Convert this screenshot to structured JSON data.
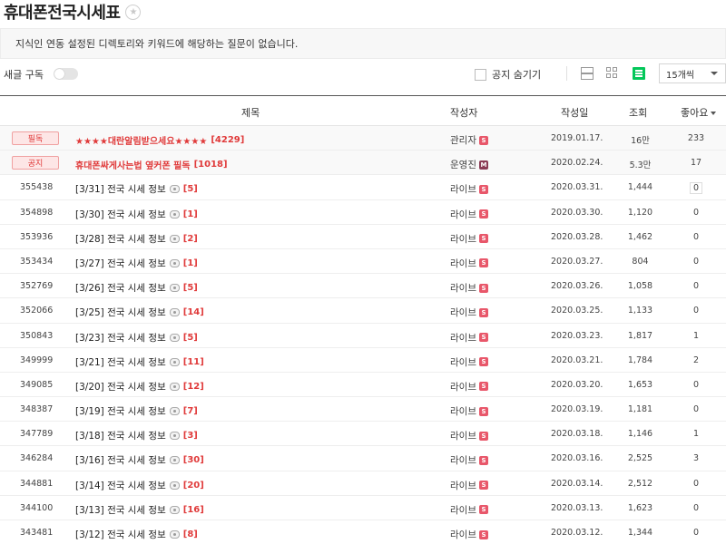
{
  "header": {
    "title": "휴대폰전국시세표",
    "star_icon": "star-icon"
  },
  "notice": "지식인 연동 설정된 디렉토리와 키워드에 해당하는 질문이 없습니다.",
  "toolbar": {
    "subscribe_label": "새글 구독",
    "hide_notice_label": "공지 숨기기",
    "view_modes": [
      "list-view-icon",
      "grid-view-icon",
      "feed-view-icon"
    ],
    "per_page": "15개씩"
  },
  "columns": {
    "title": "제목",
    "author": "작성자",
    "date": "작성일",
    "views": "조회",
    "likes": "좋아요"
  },
  "colors": {
    "accent_red": "#e03a3a",
    "level_red": "#e8576a",
    "level_dark": "#8a3b55",
    "green": "#03c75a"
  },
  "pinned": [
    {
      "badge": "필독",
      "title": "★★★★대란알림받으세요★★★★",
      "comments": "[4229]",
      "author": "관리자",
      "level": "S",
      "date": "2019.01.17.",
      "views": "16만",
      "likes": "233"
    },
    {
      "badge": "공지",
      "title": "휴대폰싸게사는법 옆커폰 필독",
      "comments": "[1018]",
      "author": "운영진",
      "level": "M",
      "date": "2020.02.24.",
      "views": "5.3만",
      "likes": "17"
    }
  ],
  "rows": [
    {
      "num": "355438",
      "title": "[3/31] 전국 시세 정보",
      "comments": "[5]",
      "author": "라이브",
      "level": "S",
      "date": "2020.03.31.",
      "views": "1,444",
      "likes": "0"
    },
    {
      "num": "354898",
      "title": "[3/30] 전국 시세 정보",
      "comments": "[1]",
      "author": "라이브",
      "level": "S",
      "date": "2020.03.30.",
      "views": "1,120",
      "likes": "0"
    },
    {
      "num": "353936",
      "title": "[3/28] 전국 시세 정보",
      "comments": "[2]",
      "author": "라이브",
      "level": "S",
      "date": "2020.03.28.",
      "views": "1,462",
      "likes": "0"
    },
    {
      "num": "353434",
      "title": "[3/27] 전국 시세 정보",
      "comments": "[1]",
      "author": "라이브",
      "level": "S",
      "date": "2020.03.27.",
      "views": "804",
      "likes": "0"
    },
    {
      "num": "352769",
      "title": "[3/26] 전국 시세 정보",
      "comments": "[5]",
      "author": "라이브",
      "level": "S",
      "date": "2020.03.26.",
      "views": "1,058",
      "likes": "0"
    },
    {
      "num": "352066",
      "title": "[3/25] 전국 시세 정보",
      "comments": "[14]",
      "author": "라이브",
      "level": "S",
      "date": "2020.03.25.",
      "views": "1,133",
      "likes": "0"
    },
    {
      "num": "350843",
      "title": "[3/23] 전국 시세 정보",
      "comments": "[5]",
      "author": "라이브",
      "level": "S",
      "date": "2020.03.23.",
      "views": "1,817",
      "likes": "1"
    },
    {
      "num": "349999",
      "title": "[3/21] 전국 시세 정보",
      "comments": "[11]",
      "author": "라이브",
      "level": "S",
      "date": "2020.03.21.",
      "views": "1,784",
      "likes": "2"
    },
    {
      "num": "349085",
      "title": "[3/20] 전국 시세 정보",
      "comments": "[12]",
      "author": "라이브",
      "level": "S",
      "date": "2020.03.20.",
      "views": "1,653",
      "likes": "0"
    },
    {
      "num": "348387",
      "title": "[3/19] 전국 시세 정보",
      "comments": "[7]",
      "author": "라이브",
      "level": "S",
      "date": "2020.03.19.",
      "views": "1,181",
      "likes": "0"
    },
    {
      "num": "347789",
      "title": "[3/18] 전국 시세 정보",
      "comments": "[3]",
      "author": "라이브",
      "level": "S",
      "date": "2020.03.18.",
      "views": "1,146",
      "likes": "1"
    },
    {
      "num": "346284",
      "title": "[3/16] 전국 시세 정보",
      "comments": "[30]",
      "author": "라이브",
      "level": "S",
      "date": "2020.03.16.",
      "views": "2,525",
      "likes": "3"
    },
    {
      "num": "344881",
      "title": "[3/14] 전국 시세 정보",
      "comments": "[20]",
      "author": "라이브",
      "level": "S",
      "date": "2020.03.14.",
      "views": "2,512",
      "likes": "0"
    },
    {
      "num": "344100",
      "title": "[3/13] 전국 시세 정보",
      "comments": "[16]",
      "author": "라이브",
      "level": "S",
      "date": "2020.03.13.",
      "views": "1,623",
      "likes": "0"
    },
    {
      "num": "343481",
      "title": "[3/12] 전국 시세 정보",
      "comments": "[8]",
      "author": "라이브",
      "level": "S",
      "date": "2020.03.12.",
      "views": "1,344",
      "likes": "0"
    }
  ]
}
